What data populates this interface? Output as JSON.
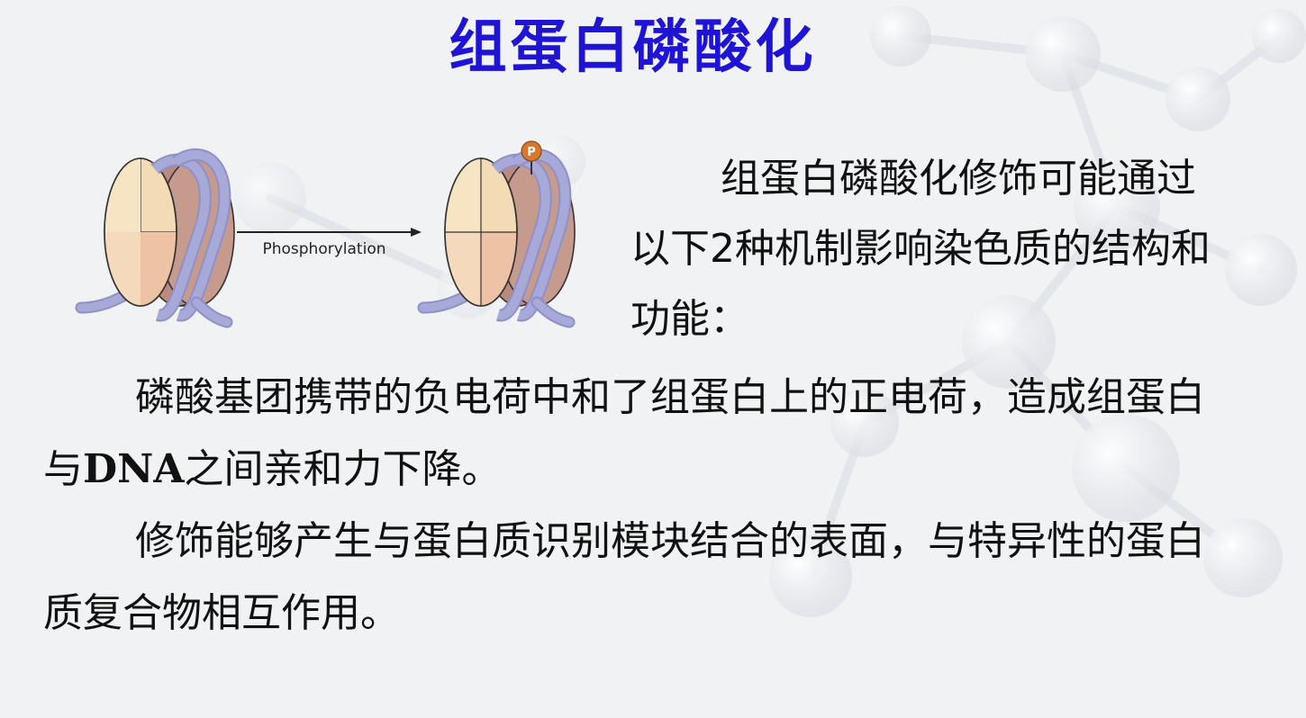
{
  "slide": {
    "title": "组蛋白磷酸化"
  },
  "figure": {
    "arrow_label": "Phosphorylation",
    "phospho_marker": "P"
  },
  "intro": {
    "text": "组蛋白磷酸化修饰可能通过以下2种机制影响染色质的结构和功能："
  },
  "mechanisms": [
    {
      "before": "磷酸基团携带的负电荷中和了组蛋白上的正电荷，造成组蛋白与",
      "latin": "DNA",
      "after": "之间亲和力下降。"
    },
    {
      "text": "修饰能够产生与蛋白质识别模块结合的表面，与特异性的蛋白质复合物相互作用。"
    }
  ],
  "colors": {
    "title": "#1f13d6",
    "histone_light": "#f3dcb5",
    "histone_dark": "#b98b7e",
    "dna_ribbon": "#a7a9d8",
    "phospho_marker": "#d8782c"
  }
}
